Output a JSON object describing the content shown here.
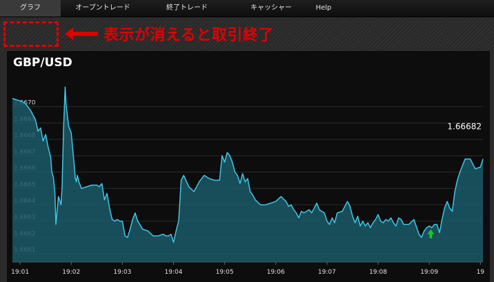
{
  "nav": {
    "tabs": [
      {
        "label": "グラフ",
        "active": true
      },
      {
        "label": "オープントレード",
        "active": false
      },
      {
        "label": "終了トレード",
        "active": false
      },
      {
        "label": "キャッシャー",
        "active": false
      },
      {
        "label": "Help",
        "active": false
      }
    ]
  },
  "annotation": {
    "text": "表示が消えると取引終了",
    "color": "#e00000"
  },
  "chart": {
    "title": "GBP/USD",
    "last_price_label": "1.66682"
  },
  "colors": {
    "line": "#3ec7e8",
    "fill": "#1b5a68",
    "marker": "#22c322",
    "background": "#0d0d0d"
  },
  "chart_data": {
    "type": "area",
    "title": "GBP/USD",
    "xlabel": "",
    "ylabel": "",
    "ylim": [
      1.66605,
      1.66718
    ],
    "yticks": [
      1.667,
      1.6669,
      1.6668,
      1.6667,
      1.6666,
      1.6665,
      1.6664,
      1.6663,
      1.6662,
      1.6661
    ],
    "ytick_labels": [
      "1.6670",
      "1.6669",
      "1.6668",
      "1.6667",
      "1.6666",
      "1.6665",
      "1.6664",
      "1.6663",
      "1.6662",
      "1.6661"
    ],
    "xticks": [
      0,
      1,
      2,
      3,
      4,
      5,
      6,
      7,
      8,
      9
    ],
    "xtick_labels": [
      "19:01",
      "19:02",
      "19:03",
      "19:04",
      "19:05",
      "19:06",
      "19:07",
      "19:08",
      "19:09",
      "19"
    ],
    "xlim": [
      -0.15,
      9.05
    ],
    "series": [
      {
        "x": [
          -0.15,
          0.05,
          0.1,
          0.2,
          0.3,
          0.35,
          0.4,
          0.45,
          0.5,
          0.55,
          0.6,
          0.62,
          0.65,
          0.68,
          0.7,
          0.75,
          0.8,
          0.82,
          0.85,
          0.88,
          0.9,
          0.95,
          1.0,
          1.05,
          1.08,
          1.1,
          1.12,
          1.15,
          1.2,
          1.3,
          1.4,
          1.45,
          1.5,
          1.55,
          1.6,
          1.65,
          1.7,
          1.75,
          1.8,
          1.85,
          1.9,
          1.95,
          2.0,
          2.05,
          2.1,
          2.15,
          2.2,
          2.25,
          2.3,
          2.4,
          2.5,
          2.6,
          2.7,
          2.8,
          2.85,
          2.9,
          2.95,
          3.0,
          3.05,
          3.1,
          3.15,
          3.2,
          3.3,
          3.4,
          3.5,
          3.6,
          3.7,
          3.8,
          3.9,
          3.95,
          4.0,
          4.05,
          4.1,
          4.15,
          4.2,
          4.25,
          4.3,
          4.35,
          4.4,
          4.45,
          4.5,
          4.55,
          4.6,
          4.7,
          4.8,
          4.9,
          5.0,
          5.1,
          5.2,
          5.25,
          5.3,
          5.35,
          5.4,
          5.45,
          5.5,
          5.55,
          5.6,
          5.65,
          5.7,
          5.75,
          5.8,
          5.85,
          5.9,
          5.95,
          6.0,
          6.05,
          6.1,
          6.15,
          6.2,
          6.3,
          6.4,
          6.45,
          6.5,
          6.55,
          6.6,
          6.65,
          6.7,
          6.75,
          6.8,
          6.85,
          6.9,
          6.95,
          7.0,
          7.05,
          7.1,
          7.15,
          7.2,
          7.25,
          7.3,
          7.35,
          7.4,
          7.45,
          7.5,
          7.6,
          7.7,
          7.8,
          7.85,
          7.9,
          7.95,
          8.0,
          8.05,
          8.1,
          8.15,
          8.2,
          8.25,
          8.3,
          8.35,
          8.4,
          8.45,
          8.5,
          8.55,
          8.6,
          8.65,
          8.7,
          8.8,
          8.9,
          9.0,
          9.05
        ],
        "y": [
          1.66705,
          1.66703,
          1.66702,
          1.66698,
          1.66692,
          1.66685,
          1.66687,
          1.66679,
          1.66683,
          1.66675,
          1.66669,
          1.6666,
          1.66657,
          1.66648,
          1.66628,
          1.66645,
          1.6664,
          1.6665,
          1.66686,
          1.66712,
          1.66701,
          1.66688,
          1.66684,
          1.66667,
          1.66656,
          1.66654,
          1.66658,
          1.66654,
          1.6665,
          1.66651,
          1.66652,
          1.66652,
          1.66652,
          1.66651,
          1.66653,
          1.66643,
          1.66647,
          1.66638,
          1.66631,
          1.6663,
          1.66631,
          1.6663,
          1.6663,
          1.66621,
          1.6662,
          1.66625,
          1.66631,
          1.66635,
          1.6663,
          1.66625,
          1.66624,
          1.66621,
          1.66621,
          1.66622,
          1.66621,
          1.66621,
          1.66622,
          1.66617,
          1.66624,
          1.6663,
          1.66655,
          1.66658,
          1.66651,
          1.66648,
          1.66654,
          1.66658,
          1.66656,
          1.66655,
          1.66655,
          1.6667,
          1.66666,
          1.66672,
          1.6667,
          1.66666,
          1.6666,
          1.66658,
          1.66653,
          1.66659,
          1.66654,
          1.66656,
          1.66648,
          1.66646,
          1.66643,
          1.6664,
          1.6664,
          1.66641,
          1.66642,
          1.66645,
          1.66642,
          1.66639,
          1.6664,
          1.66637,
          1.66635,
          1.66632,
          1.66636,
          1.66635,
          1.66636,
          1.66637,
          1.66635,
          1.66638,
          1.66641,
          1.66637,
          1.66636,
          1.66635,
          1.6663,
          1.66628,
          1.66632,
          1.66629,
          1.66635,
          1.66636,
          1.66642,
          1.66639,
          1.66633,
          1.66629,
          1.66633,
          1.66627,
          1.6663,
          1.66627,
          1.66629,
          1.66626,
          1.66629,
          1.66631,
          1.66634,
          1.6663,
          1.66629,
          1.66631,
          1.6663,
          1.66632,
          1.66629,
          1.66627,
          1.66632,
          1.66631,
          1.66628,
          1.66628,
          1.66631,
          1.66622,
          1.6662,
          1.66624,
          1.66626,
          1.66627,
          1.66626,
          1.66628,
          1.66628,
          1.66623,
          1.66631,
          1.66638,
          1.66642,
          1.66638,
          1.66636,
          1.66648,
          1.66655,
          1.6666,
          1.66664,
          1.66668,
          1.66668,
          1.66662,
          1.66663,
          1.66668
        ]
      }
    ],
    "markers": [
      {
        "type": "up-arrow",
        "x": 8.03,
        "y": 1.66622,
        "color": "#22c322"
      }
    ],
    "last_value": 1.66682,
    "grid": true,
    "legend": "none"
  }
}
